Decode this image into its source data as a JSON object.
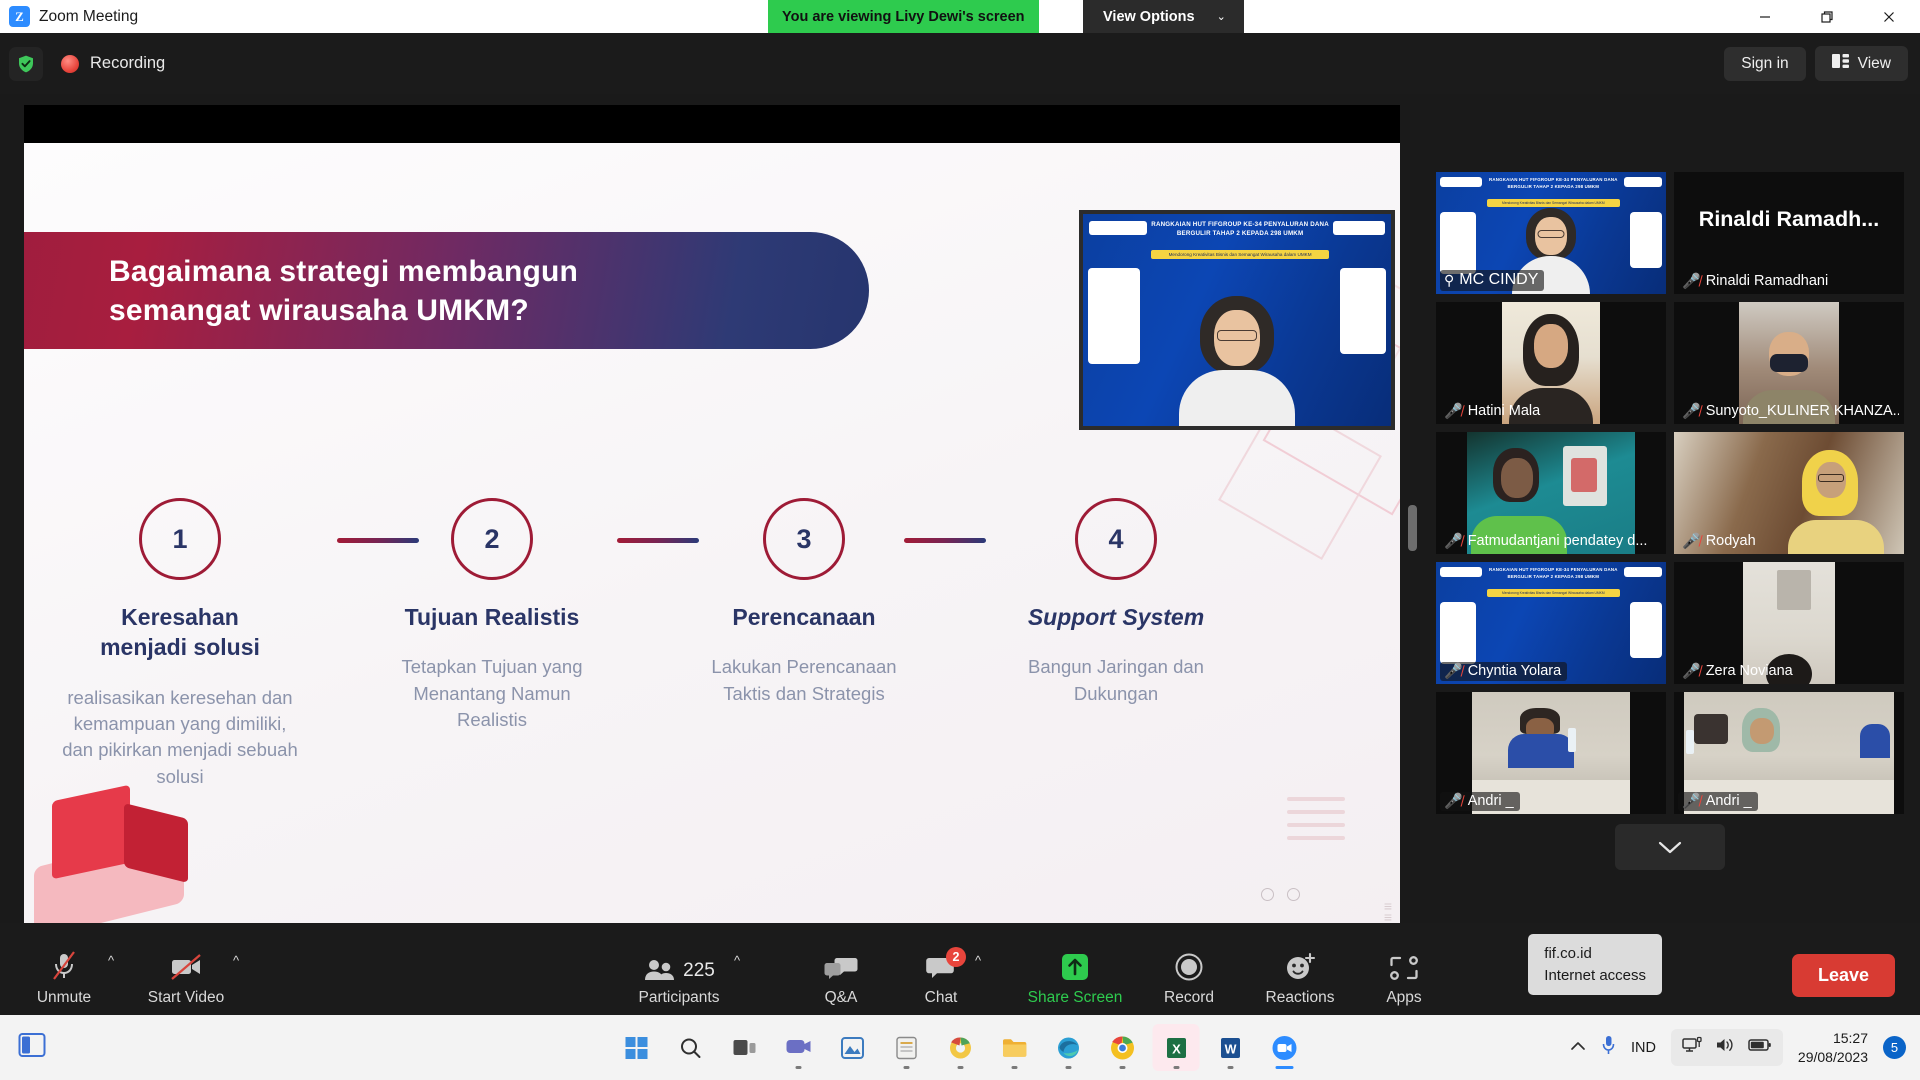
{
  "titlebar": {
    "logo_icon": "zoom-logo-icon",
    "title": "Zoom Meeting",
    "share_banner": "You are viewing Livy Dewi's screen",
    "view_options": "View Options",
    "chevron": "⌄",
    "minimize_icon": "minimize-icon",
    "restore_icon": "restore-icon",
    "close_icon": "close-icon"
  },
  "topbar": {
    "shield_icon": "shield-check-icon",
    "recording_label": "Recording",
    "sign_in": "Sign in",
    "view": "View",
    "view_icon": "layout-view-icon"
  },
  "slide": {
    "title_line1": "Bagaimana strategi membangun",
    "title_line2": "semangat wirausaha UMKM?",
    "steps": [
      {
        "number": "1",
        "heading_line1": "Keresahan",
        "heading_line2": "menjadi solusi",
        "body": "realisasikan keresehan dan kemampuan yang dimiliki, dan pikirkan menjadi sebuah solusi"
      },
      {
        "number": "2",
        "heading_line1": "Tujuan Realistis",
        "heading_line2": "",
        "body": "Tetapkan Tujuan yang Menantang Namun Realistis"
      },
      {
        "number": "3",
        "heading_line1": "Perencanaan",
        "heading_line2": "",
        "body": "Lakukan Perencanaan Taktis dan Strategis"
      },
      {
        "number": "4",
        "heading_line1": "Support System",
        "heading_line2": "",
        "body": "Bangun Jaringan dan Dukungan"
      }
    ]
  },
  "presenter_thumb": {
    "slide_title": "RANGKAIAN HUT FIFGROUP KE-34 PENYALURAN DANA BERGULIR TAHAP 2 KEPADA 298 UMKM",
    "slide_subtitle": "Mendorong Kreativitas Bisnis dan Semangat Wirausaha dalam UMKM"
  },
  "gallery": {
    "tiles": [
      {
        "name": "MC CINDY",
        "state": "active-pinned",
        "mic": "on",
        "pin": true
      },
      {
        "name": "Rinaldi  Ramadh...",
        "secondary_name": "Rinaldi Ramadhani",
        "state": "audio-only",
        "mic": "off",
        "pin": false
      },
      {
        "name": "Hatini Mala",
        "state": "video",
        "mic": "off",
        "pin": false
      },
      {
        "name": "Sunyoto_KULINER KHANZA...",
        "state": "video",
        "mic": "off",
        "pin": false
      },
      {
        "name": "Fatmudantjani pendatey d...",
        "state": "video",
        "mic": "off",
        "pin": false
      },
      {
        "name": "Rodyah",
        "state": "video",
        "mic": "off",
        "pin": false
      },
      {
        "name": "Chyntia Yolara",
        "state": "video",
        "mic": "off",
        "pin": false
      },
      {
        "name": "Zera Noviana",
        "state": "video",
        "mic": "off",
        "pin": false
      },
      {
        "name": "Andri _",
        "state": "video",
        "mic": "off",
        "pin": false
      },
      {
        "name": "Andri _",
        "state": "video",
        "mic": "off",
        "pin": false
      }
    ],
    "scroll_down_icon": "chevron-down-icon"
  },
  "toolbar": {
    "unmute": {
      "label": "Unmute",
      "icon": "mic-off-icon"
    },
    "start_video": {
      "label": "Start Video",
      "icon": "video-off-icon"
    },
    "participants": {
      "label": "Participants",
      "count": "225",
      "icon": "people-icon"
    },
    "qa": {
      "label": "Q&A",
      "icon": "qa-bubbles-icon"
    },
    "chat": {
      "label": "Chat",
      "badge": "2",
      "icon": "chat-bubble-icon"
    },
    "share_screen": {
      "label": "Share Screen",
      "icon": "share-up-arrow-icon"
    },
    "record": {
      "label": "Record",
      "icon": "record-circle-icon"
    },
    "reactions": {
      "label": "Reactions",
      "icon": "smiley-plus-icon"
    },
    "apps": {
      "label": "Apps",
      "icon": "apps-brackets-icon"
    },
    "leave": "Leave",
    "tooltip_line1": "fif.co.id",
    "tooltip_line2": "Internet access"
  },
  "taskbar": {
    "start_icon": "windows-start-icon",
    "search_icon": "search-icon",
    "taskview_icon": "task-view-icon",
    "apps": [
      {
        "icon": "teams-icon"
      },
      {
        "icon": "photos-icon"
      },
      {
        "icon": "notes-icon"
      },
      {
        "icon": "chrome-canary-icon"
      },
      {
        "icon": "file-explorer-icon"
      },
      {
        "icon": "edge-icon"
      },
      {
        "icon": "chrome-icon"
      },
      {
        "icon": "excel-icon"
      },
      {
        "icon": "word-icon"
      },
      {
        "icon": "zoom-icon"
      }
    ],
    "tray": {
      "overflow_icon": "chevron-up-icon",
      "mic_icon": "microphone-icon",
      "language": "IND",
      "network_icon": "network-icon",
      "volume_icon": "volume-icon",
      "battery_icon": "battery-charging-icon",
      "time": "15:27",
      "date": "29/08/2023",
      "notification_count": "5"
    }
  }
}
